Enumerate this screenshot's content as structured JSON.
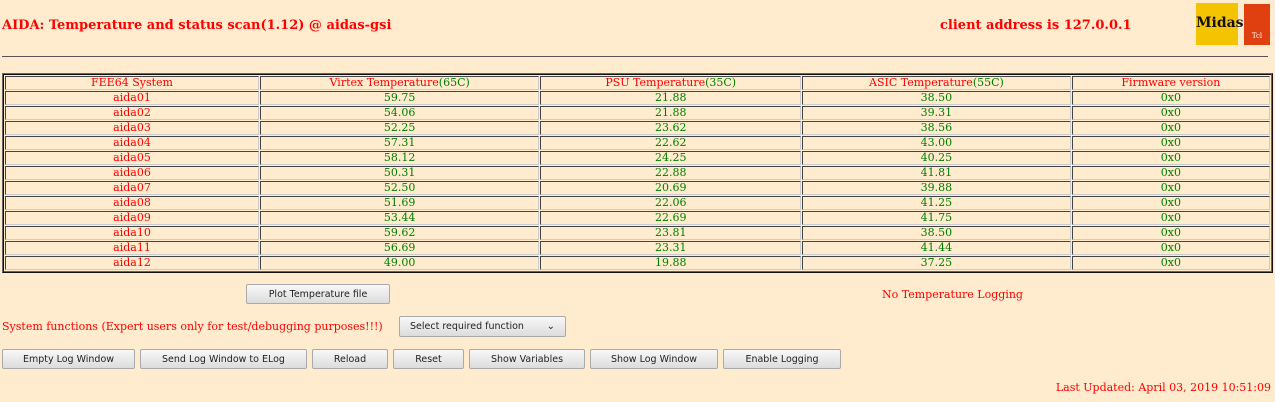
{
  "header": {
    "title": "AIDA: Temperature and status scan(1.12) @ aidas-gsi",
    "client": "client address is 127.0.0.1",
    "logo_midas": "Midas",
    "logo_tcl": "Tcl"
  },
  "colors": {
    "background": "#ffebcd",
    "label": "#ff0000",
    "value": "#008000"
  },
  "table": {
    "headers": [
      {
        "label": "FEE64 System",
        "limit": ""
      },
      {
        "label": "Virtex Temperature",
        "limit": "(65C)"
      },
      {
        "label": "PSU Temperature",
        "limit": "(35C)"
      },
      {
        "label": "ASIC Temperature",
        "limit": "(55C)"
      },
      {
        "label": "Firmware version",
        "limit": ""
      }
    ],
    "rows": [
      [
        "aida01",
        "59.75",
        "21.88",
        "38.50",
        "0x0"
      ],
      [
        "aida02",
        "54.06",
        "21.88",
        "39.31",
        "0x0"
      ],
      [
        "aida03",
        "52.25",
        "23.62",
        "38.56",
        "0x0"
      ],
      [
        "aida04",
        "57.31",
        "22.62",
        "43.00",
        "0x0"
      ],
      [
        "aida05",
        "58.12",
        "24.25",
        "40.25",
        "0x0"
      ],
      [
        "aida06",
        "50.31",
        "22.88",
        "41.81",
        "0x0"
      ],
      [
        "aida07",
        "52.50",
        "20.69",
        "39.88",
        "0x0"
      ],
      [
        "aida08",
        "51.69",
        "22.06",
        "41.25",
        "0x0"
      ],
      [
        "aida09",
        "53.44",
        "22.69",
        "41.75",
        "0x0"
      ],
      [
        "aida10",
        "59.62",
        "23.81",
        "38.50",
        "0x0"
      ],
      [
        "aida11",
        "56.69",
        "23.31",
        "41.44",
        "0x0"
      ],
      [
        "aida12",
        "49.00",
        "19.88",
        "37.25",
        "0x0"
      ]
    ]
  },
  "plot_button": "Plot Temperature file",
  "logging_status": "No Temperature Logging",
  "system_functions_label": "System functions (Expert users only for test/debugging purposes!!!)",
  "select": {
    "selected": "Select required function"
  },
  "buttons": [
    "Empty Log Window",
    "Send Log Window to ELog",
    "Reload",
    "Reset",
    "Show Variables",
    "Show Log Window",
    "Enable Logging"
  ],
  "last_updated": "Last Updated: April 03, 2019 10:51:09"
}
